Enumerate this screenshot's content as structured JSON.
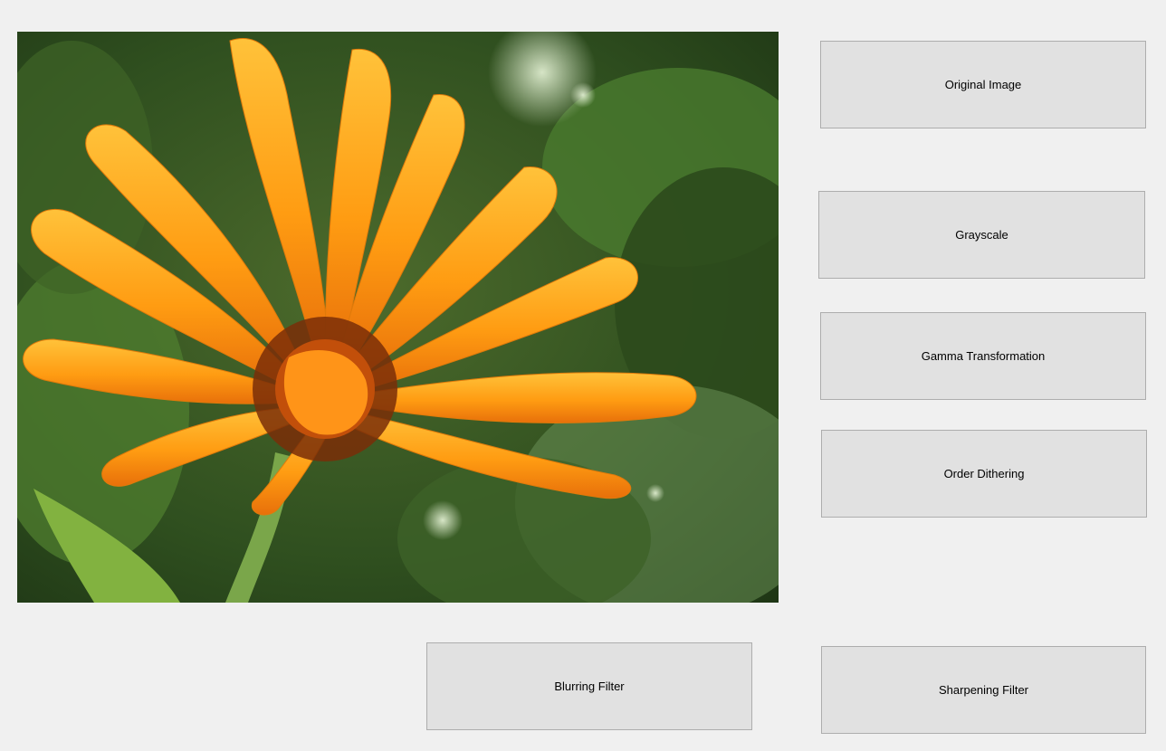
{
  "image_display": {
    "subject": "flower-photo"
  },
  "buttons": {
    "original": "Original Image",
    "grayscale": "Grayscale",
    "gamma": "Gamma Transformation",
    "dither": "Order Dithering",
    "blur": "Blurring Filter",
    "sharpen": "Sharpening Filter"
  },
  "colors": {
    "form_background": "#f0f0f0",
    "button_face": "#e1e1e1",
    "button_border": "#adadad"
  }
}
